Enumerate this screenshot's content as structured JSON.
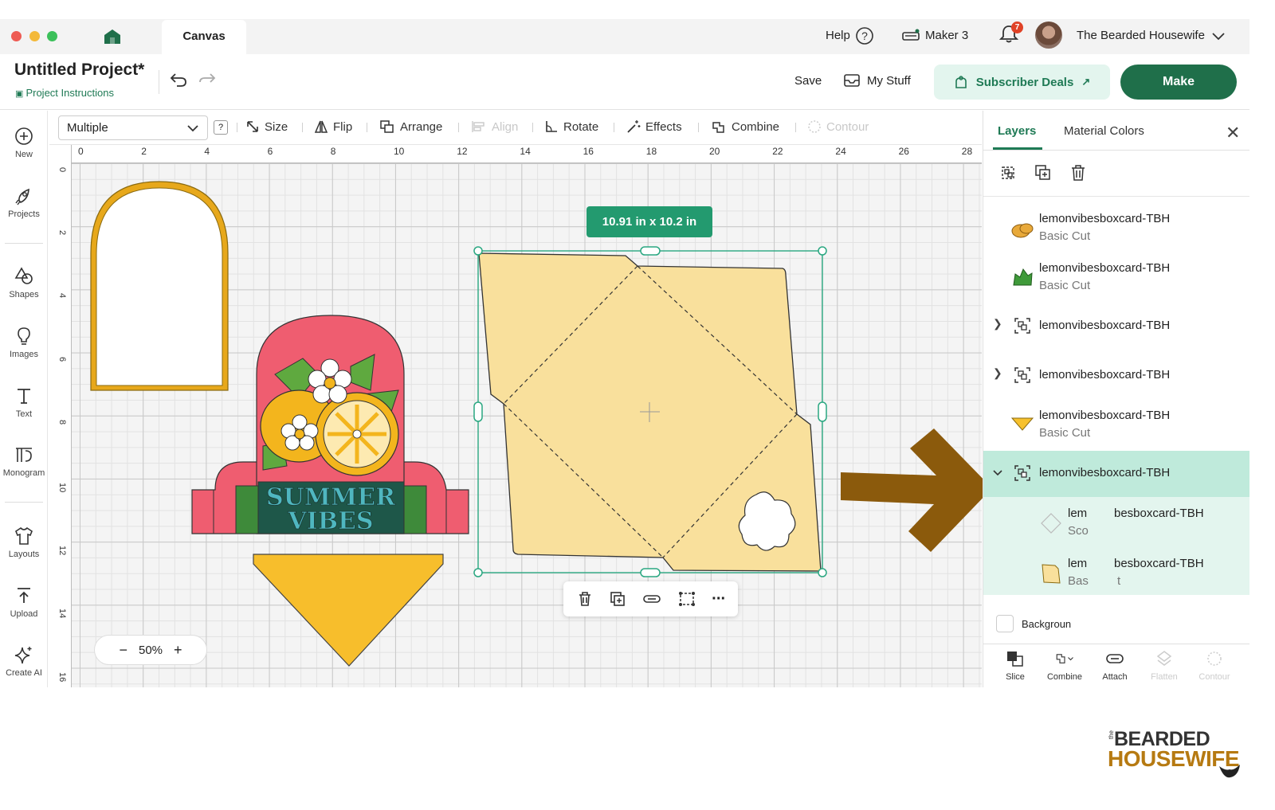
{
  "window": {
    "tab_title": "Canvas",
    "help_label": "Help",
    "machine_label": "Maker 3",
    "notification_count": "7",
    "user_name": "The Bearded Housewife"
  },
  "project": {
    "title": "Untitled Project*",
    "instructions_label": "Project Instructions"
  },
  "header": {
    "save_label": "Save",
    "mystuff_label": "My Stuff",
    "deals_label": "Subscriber Deals",
    "make_label": "Make"
  },
  "leftnav": {
    "items": [
      {
        "label": "New",
        "icon": "plus-circle-icon"
      },
      {
        "label": "Projects",
        "icon": "rocket-icon"
      },
      {
        "label": "Shapes",
        "icon": "shapes-icon"
      },
      {
        "label": "Images",
        "icon": "lightbulb-icon"
      },
      {
        "label": "Text",
        "icon": "text-icon"
      },
      {
        "label": "Monogram",
        "icon": "monogram-icon"
      },
      {
        "label": "Layouts",
        "icon": "shirt-icon"
      },
      {
        "label": "Upload",
        "icon": "upload-icon"
      },
      {
        "label": "Create AI",
        "icon": "sparkle-icon"
      }
    ]
  },
  "toolbar": {
    "operation_value": "Multiple",
    "help": "?",
    "size": "Size",
    "flip": "Flip",
    "arrange": "Arrange",
    "align": "Align",
    "rotate": "Rotate",
    "effects": "Effects",
    "combine": "Combine",
    "contour": "Contour"
  },
  "ruler": {
    "top": [
      "0",
      "2",
      "4",
      "6",
      "8",
      "10",
      "12",
      "14",
      "16",
      "18",
      "20",
      "22",
      "24",
      "26",
      "28"
    ],
    "left": [
      "0",
      "2",
      "4",
      "6",
      "8",
      "10",
      "12",
      "14",
      "16"
    ]
  },
  "canvas": {
    "dimension_label": "10.91  in x 10.2  in",
    "zoom_label": "50%",
    "zoom_minus": "−",
    "zoom_plus": "+",
    "sign_text_1": "SUMMER",
    "sign_text_2": "VIBES",
    "more": "···"
  },
  "panel": {
    "tab_layers": "Layers",
    "tab_colors": "Material Colors",
    "close": "✕",
    "layers": [
      {
        "name": "lemonvibesboxcard-TBH",
        "sub": "Basic Cut",
        "swatch": "#e8a93a"
      },
      {
        "name": "lemonvibesboxcard-TBH",
        "sub": "Basic Cut",
        "swatch": "#3f9a3a"
      },
      {
        "name": "lemonvibesboxcard-TBH",
        "sub": "",
        "group": true
      },
      {
        "name": "lemonvibesboxcard-TBH",
        "sub": "",
        "group": true
      },
      {
        "name": "lemonvibesboxcard-TBH",
        "sub": "Basic Cut",
        "swatch": "#f7c12d"
      },
      {
        "name": "lemonvibesboxcard-TBH",
        "sub": "",
        "group": true,
        "expanded": true
      }
    ],
    "child1_name_a": "lem",
    "child1_name_b": "besboxcard-TBH",
    "child1_sub": "Sco",
    "child2_name_a": "lem",
    "child2_name_b": "besboxcard-TBH",
    "child2_sub_a": "Bas",
    "child2_sub_b": "t",
    "background_label": "Backgroun",
    "bottom": {
      "slice": "Slice",
      "combine": "Combine",
      "attach": "Attach",
      "flatten": "Flatten",
      "contour": "Contour"
    }
  },
  "logo": {
    "the": "the",
    "line1": "BEARDED",
    "line2": "HOUSEWIFE"
  },
  "colors": {
    "accent_green": "#1f6f4a",
    "teal": "#239a6f",
    "arrow_brown": "#8b5a0c",
    "envelope_fill": "#f9e09c"
  }
}
